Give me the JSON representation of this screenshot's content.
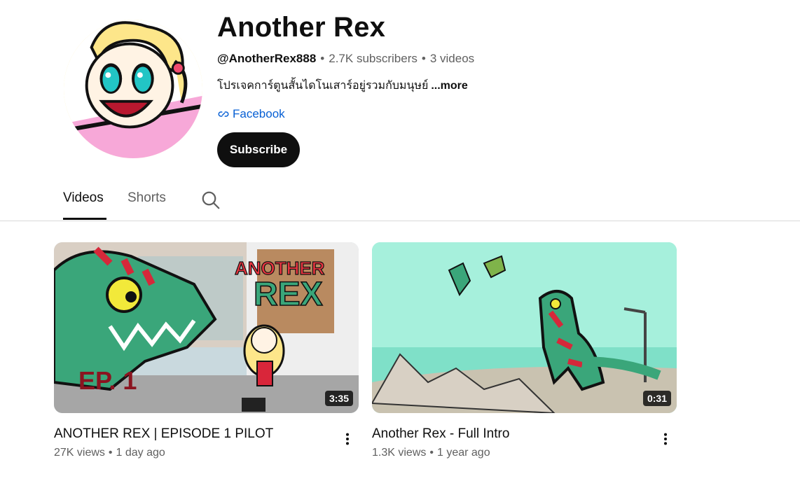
{
  "channel": {
    "title": "Another Rex",
    "handle": "@AnotherRex888",
    "subscribers": "2.7K subscribers",
    "videos_count": "3 videos",
    "separator": "•",
    "description": "โปรเจคการ์ตูนสั้นไดโนเสาร์อยู่รวมกับมนุษย์",
    "more_label": "...more",
    "link_label": "Facebook",
    "subscribe_label": "Subscribe"
  },
  "tabs": [
    {
      "label": "Videos",
      "active": true
    },
    {
      "label": "Shorts",
      "active": false
    }
  ],
  "videos": [
    {
      "title": "ANOTHER REX | EPISODE 1 PILOT",
      "views": "27K views",
      "age": "1 day ago",
      "duration": "3:35",
      "thumb_text_logo_1": "ANOTHER",
      "thumb_text_logo_2": "REX",
      "thumb_episode": "EP. 1"
    },
    {
      "title": "Another Rex - Full Intro",
      "views": "1.3K views",
      "age": "1 year ago",
      "duration": "0:31"
    }
  ],
  "icons": {
    "link": "link-icon",
    "search": "search-icon",
    "more_vert": "more-vert-icon"
  },
  "colors": {
    "link": "#065fd4",
    "subscribe_bg": "#0f0f0f",
    "text_secondary": "#606060"
  }
}
